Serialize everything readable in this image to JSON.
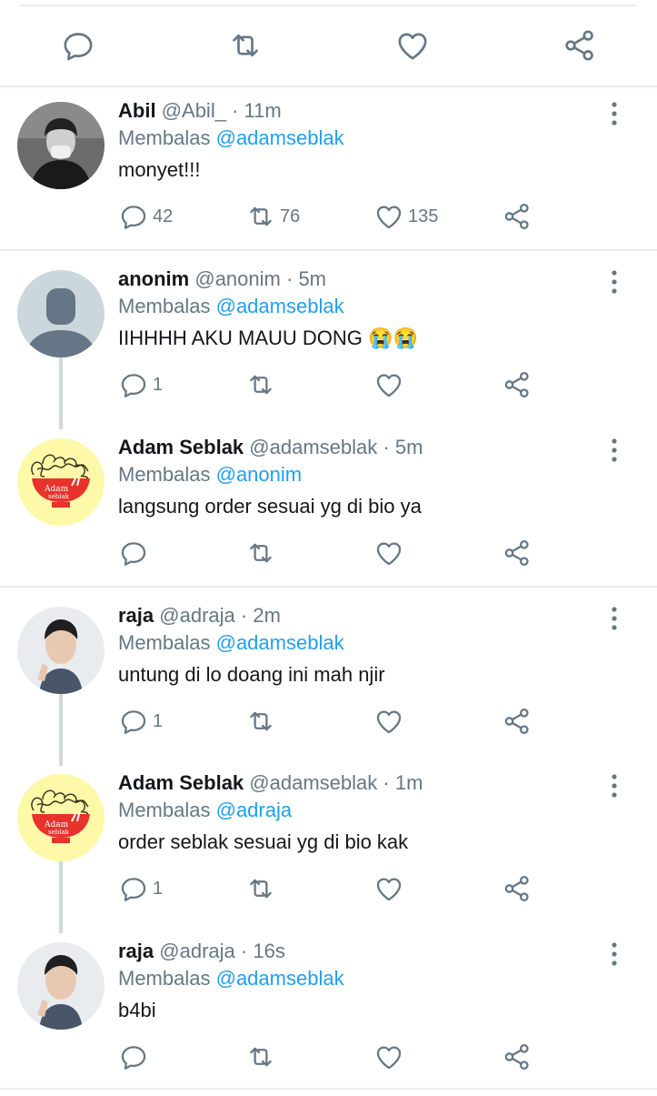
{
  "top_actions": {
    "reply_icon": "reply-icon",
    "retweet_icon": "retweet-icon",
    "like_icon": "heart-icon",
    "share_icon": "share-icon"
  },
  "labels": {
    "replying_to": "Membalas"
  },
  "colors": {
    "accent": "#1da1f2",
    "muted": "#657786",
    "text": "#14171a",
    "separator": "#e6ecf0"
  },
  "tweets": [
    {
      "name": "Abil",
      "handle": "@Abil_",
      "dot": "·",
      "time": "11m",
      "reply_to": "@adamseblak",
      "text": "monyet!!!",
      "replies": "42",
      "retweets": "76",
      "likes": "135",
      "avatar": "photo-bw"
    },
    {
      "name": "anonim",
      "handle": "@anonim",
      "dot": "·",
      "time": "5m",
      "reply_to": "@adamseblak",
      "text": "IIHHHH AKU MAUU DONG",
      "emoji": "😭😭",
      "replies": "1",
      "retweets": "",
      "likes": "",
      "avatar": "default"
    },
    {
      "name": "Adam Seblak",
      "handle": "@adamseblak",
      "dot": "·",
      "time": "5m",
      "reply_to": "@anonim",
      "text": "langsung order sesuai yg di bio ya",
      "replies": "",
      "retweets": "",
      "likes": "",
      "avatar": "logo"
    },
    {
      "name": "raja",
      "handle": "@adraja",
      "dot": "·",
      "time": "2m",
      "reply_to": "@adamseblak",
      "text": "untung di lo doang ini mah njir",
      "replies": "1",
      "retweets": "",
      "likes": "",
      "avatar": "photo"
    },
    {
      "name": "Adam Seblak",
      "handle": "@adamseblak",
      "dot": "·",
      "time": "1m",
      "reply_to": "@adraja",
      "text": "order seblak sesuai yg di bio kak",
      "replies": "1",
      "retweets": "",
      "likes": "",
      "avatar": "logo"
    },
    {
      "name": "raja",
      "handle": "@adraja",
      "dot": "·",
      "time": "16s",
      "reply_to": "@adamseblak",
      "text": "b4bi",
      "replies": "",
      "retweets": "",
      "likes": "",
      "avatar": "photo"
    }
  ]
}
